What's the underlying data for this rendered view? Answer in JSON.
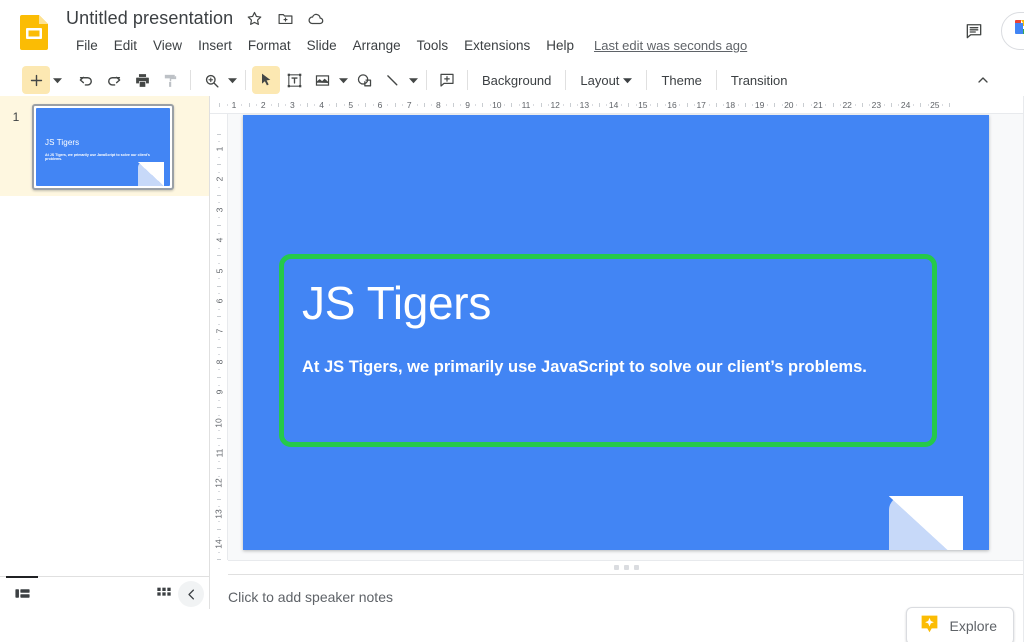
{
  "app": {
    "name": "Google Slides",
    "logo_icon": "slides-logo-icon"
  },
  "header": {
    "doc_title": "Untitled presentation",
    "icons": [
      {
        "name": "star-icon",
        "title": "Star"
      },
      {
        "name": "move-to-folder-icon",
        "title": "Move"
      },
      {
        "name": "cloud-saved-icon",
        "title": "Saved to Drive"
      }
    ],
    "menus": [
      {
        "label": "File"
      },
      {
        "label": "Edit"
      },
      {
        "label": "View"
      },
      {
        "label": "Insert"
      },
      {
        "label": "Format"
      },
      {
        "label": "Slide"
      },
      {
        "label": "Arrange"
      },
      {
        "label": "Tools"
      },
      {
        "label": "Extensions"
      },
      {
        "label": "Help"
      }
    ],
    "last_edit": "Last edit was seconds ago",
    "comment_icon": "comment-history-icon",
    "meet_icon": "google-meet-icon",
    "meet_caret_icon": "chevron-down-icon"
  },
  "toolbar": {
    "new_slide_icon": "add-slide-icon",
    "new_slide_caret_icon": "chevron-down-icon",
    "undo_icon": "undo-icon",
    "redo_icon": "redo-icon",
    "print_icon": "print-icon",
    "paint_format_icon": "paint-format-icon",
    "zoom_icon": "zoom-icon",
    "zoom_caret_icon": "chevron-down-icon",
    "select_icon": "select-arrow-icon",
    "textbox_icon": "text-box-icon",
    "image_icon": "insert-image-icon",
    "image_caret_icon": "chevron-down-icon",
    "shape_icon": "shape-icon",
    "line_icon": "line-icon",
    "line_caret_icon": "chevron-down-icon",
    "comment_icon": "add-comment-icon",
    "background_label": "Background",
    "layout_label": "Layout",
    "layout_caret_icon": "chevron-down-icon",
    "theme_label": "Theme",
    "transition_label": "Transition",
    "collapse_icon": "chevron-up-icon"
  },
  "filmstrip": {
    "slides": [
      {
        "number": "1",
        "title": "JS Tigers",
        "subtitle": "At JS Tigers, we primarily use JavaScript to solve our client’s problems.",
        "selected": true
      }
    ],
    "footer": {
      "filmstrip_view_icon": "filmstrip-view-icon",
      "grid_view_icon": "grid-view-icon",
      "collapse_icon": "chevron-left-icon"
    }
  },
  "rulers": {
    "horizontal_ticks": [
      "1",
      "2",
      "3",
      "4",
      "5",
      "6",
      "7",
      "8",
      "9",
      "10",
      "11",
      "12",
      "13",
      "14",
      "15",
      "16",
      "17",
      "18",
      "19",
      "20",
      "21",
      "22",
      "23",
      "24",
      "25"
    ],
    "vertical_ticks": [
      "1",
      "2",
      "3",
      "4",
      "5",
      "6",
      "7",
      "8",
      "9",
      "10",
      "11",
      "12",
      "13",
      "14"
    ]
  },
  "slide": {
    "background_color": "#4285f4",
    "textbox": {
      "border_color": "#25c94a",
      "title": "JS Tigers",
      "subtitle": "At JS Tigers, we primarily use JavaScript to solve our client’s problems.",
      "text_color": "#ffffff"
    },
    "decoration_color": "#c7d9f9"
  },
  "notes": {
    "placeholder": "Click to add speaker notes",
    "explore_label": "Explore",
    "explore_icon": "explore-sparkle-icon",
    "explore_icon_color": "#fbbc04",
    "resize_handle_icon": "resize-dots-icon"
  }
}
